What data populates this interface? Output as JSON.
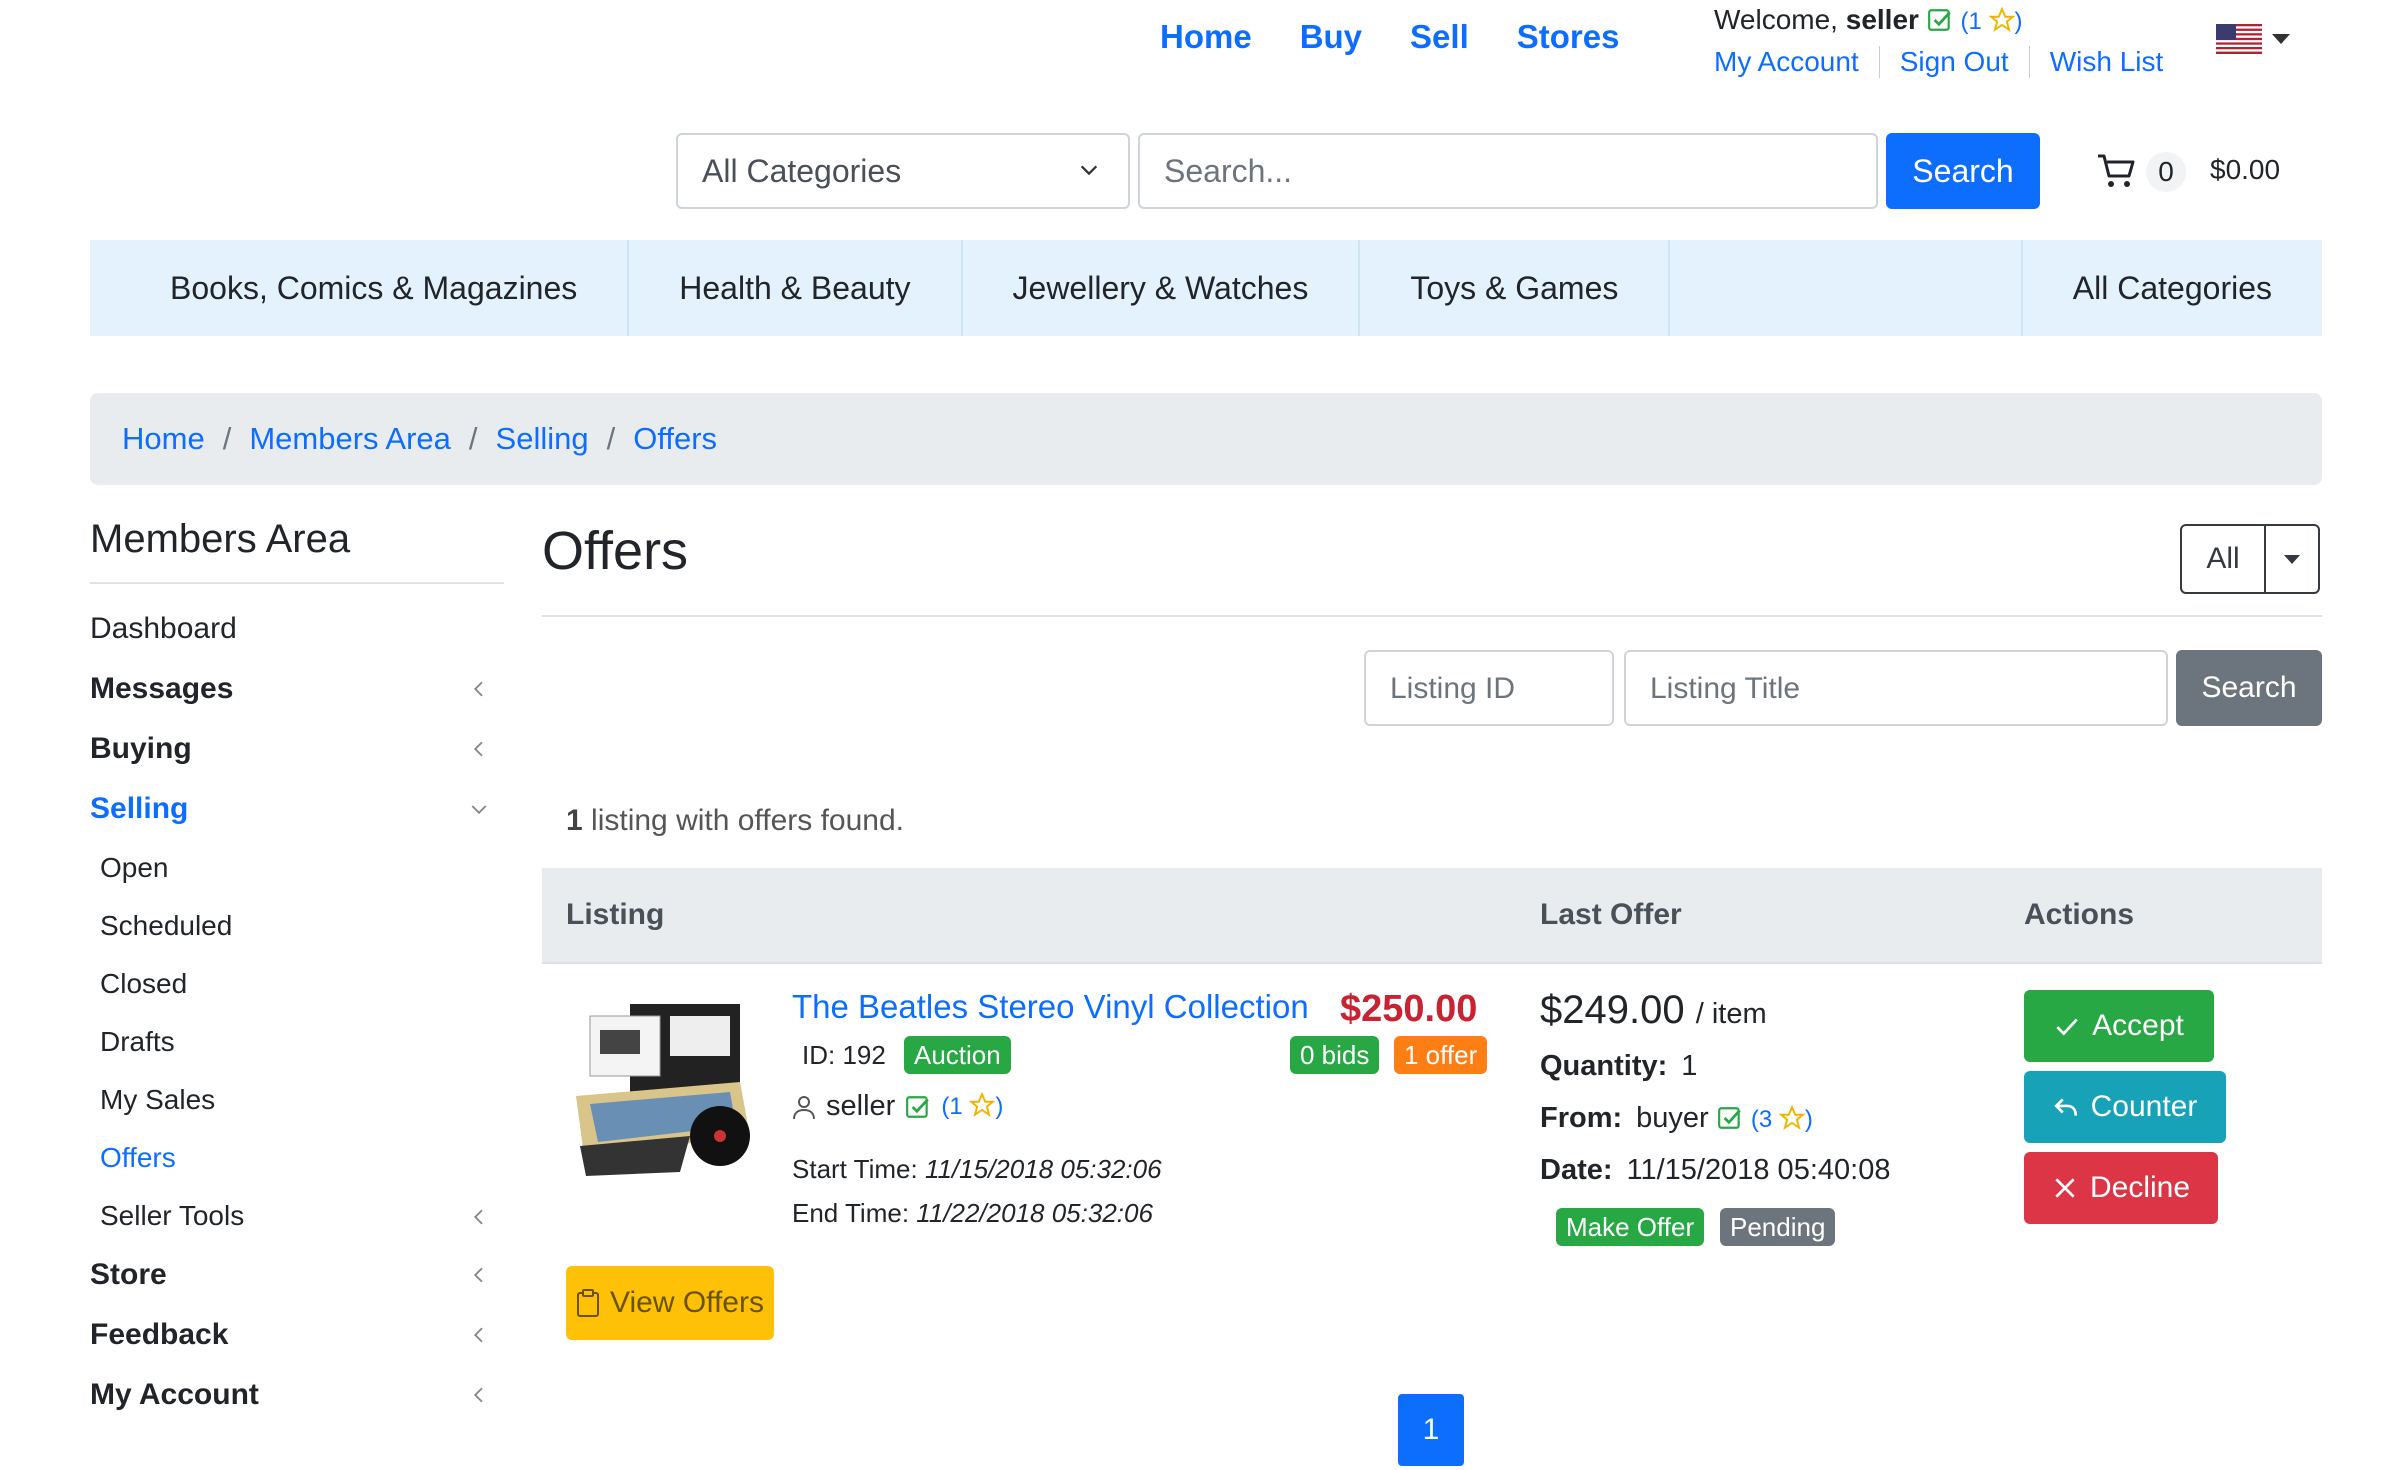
{
  "topnav": {
    "home": "Home",
    "buy": "Buy",
    "sell": "Sell",
    "stores": "Stores"
  },
  "welcome": {
    "prefix": "Welcome,",
    "user": "seller",
    "rating_open": "(",
    "rating_count": "1",
    "rating_close": ")"
  },
  "account_links": {
    "my_account": "My Account",
    "sign_out": "Sign Out",
    "wish_list": "Wish List"
  },
  "locale_icon": "us-flag-icon",
  "search": {
    "category": "All Categories",
    "placeholder": "Search...",
    "button": "Search"
  },
  "cart": {
    "count": "0",
    "total": "$0.00"
  },
  "categories": [
    "Books, Comics & Magazines",
    "Health & Beauty",
    "Jewellery & Watches",
    "Toys & Games",
    "All Categories"
  ],
  "breadcrumb": [
    "Home",
    "Members Area",
    "Selling",
    "Offers"
  ],
  "sidebar": {
    "title": "Members Area",
    "dashboard": "Dashboard",
    "messages": "Messages",
    "buying": "Buying",
    "selling": "Selling",
    "selling_sub": [
      "Open",
      "Scheduled",
      "Closed",
      "Drafts",
      "My Sales",
      "Offers"
    ],
    "seller_tools": "Seller Tools",
    "store": "Store",
    "feedback": "Feedback",
    "my_account": "My Account"
  },
  "main": {
    "title": "Offers",
    "filter": "All",
    "listing_id_placeholder": "Listing ID",
    "listing_title_placeholder": "Listing Title",
    "search_button": "Search",
    "found_count": "1",
    "found_text": "listing with offers found."
  },
  "table": {
    "headers": {
      "listing": "Listing",
      "last_offer": "Last Offer",
      "actions": "Actions"
    },
    "row": {
      "title": "The Beatles Stereo Vinyl Collection",
      "price": "$250.00",
      "id_label": "ID: 192",
      "type_badge": "Auction",
      "bids_badge": "0 bids",
      "offers_badge": "1 offer",
      "seller": "seller",
      "seller_rating_open": "(",
      "seller_rating": "1",
      "seller_rating_close": ")",
      "start_label": "Start Time:",
      "start_time": "11/15/2018 05:32:06",
      "end_label": "End Time:",
      "end_time": "11/22/2018 05:32:06",
      "view_offers": "View Offers",
      "offer_amount": "$249.00",
      "offer_unit": "/ item",
      "quantity_label": "Quantity:",
      "quantity": "1",
      "from_label": "From:",
      "from_user": "buyer",
      "from_rating_open": "(",
      "from_rating": "3",
      "from_rating_close": ")",
      "date_label": "Date:",
      "date": "11/15/2018 05:40:08",
      "offer_type_badge": "Make Offer",
      "status_badge": "Pending",
      "accept": "Accept",
      "counter": "Counter",
      "decline": "Decline"
    }
  },
  "pagination": {
    "current": "1"
  },
  "colors": {
    "primary": "#0d6efd",
    "success": "#28a745",
    "info": "#17a2b8",
    "danger": "#dc3545",
    "warning": "#ffc107",
    "orange": "#fd7e14",
    "price_red": "#c82333",
    "category_bar": "#e3f2fd"
  }
}
